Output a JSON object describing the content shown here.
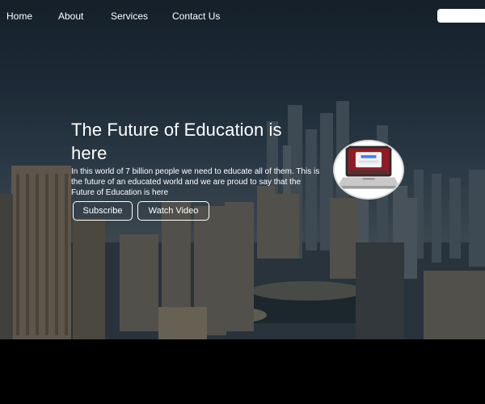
{
  "nav": {
    "items": [
      {
        "label": "Home"
      },
      {
        "label": "About"
      },
      {
        "label": "Services"
      },
      {
        "label": "Contact Us"
      }
    ],
    "search": {
      "placeholder": "",
      "value": ""
    }
  },
  "hero": {
    "title": "The Future of Education is here",
    "text": "In this world of 7 billion people we need to educate all of them. This is the future of an educated world and we are proud to say that the Future of Education is here",
    "buttons": {
      "subscribe": "Subscribe",
      "watch_video": "Watch Video"
    },
    "image": {
      "icon": "laptop-icon"
    }
  },
  "colors": {
    "text": "#ffffff",
    "footer": "#000000",
    "button_border": "#ffffff"
  }
}
